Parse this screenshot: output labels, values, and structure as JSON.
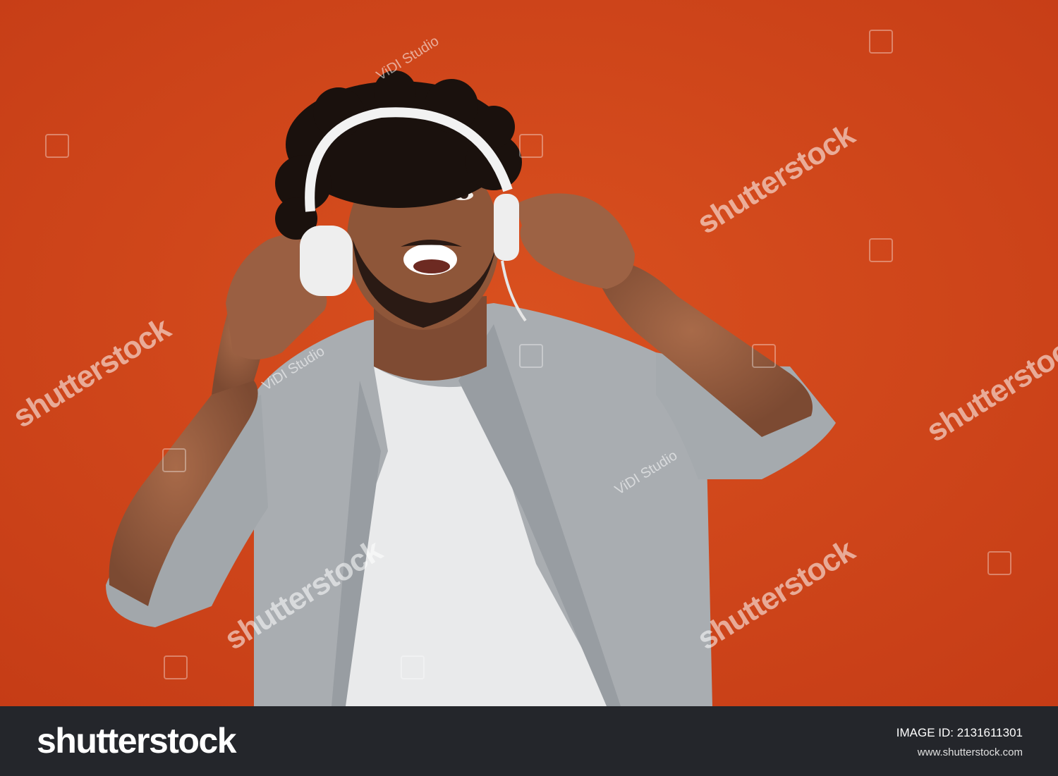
{
  "image": {
    "background_color": "#d2461c",
    "subject": "man-with-headphones"
  },
  "watermarks": {
    "brand": "shutterstock",
    "studio": "ViDI Studio",
    "color": "#ffffff"
  },
  "footer": {
    "logo": "shutterstock",
    "image_id_label": "IMAGE ID: 2131611301",
    "url": "www.shutterstock.com",
    "background": "#24262b"
  }
}
